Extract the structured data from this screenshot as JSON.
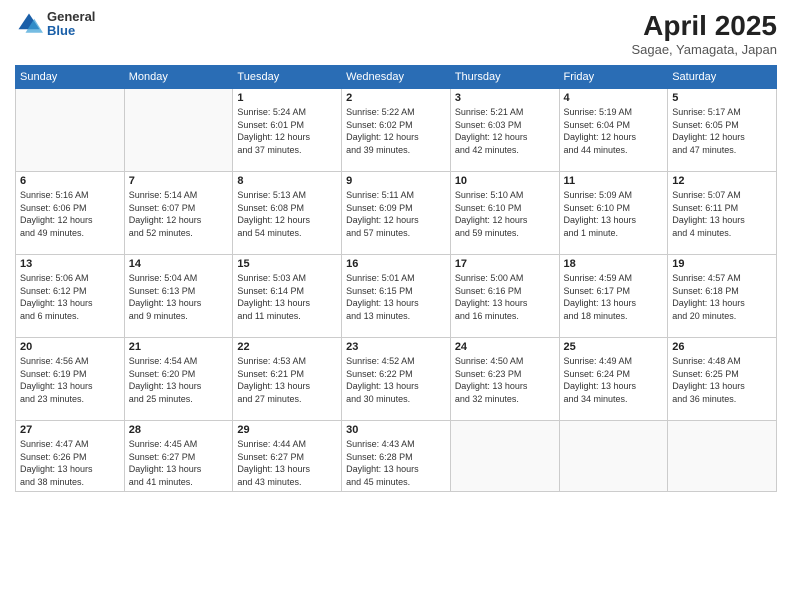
{
  "header": {
    "logo_general": "General",
    "logo_blue": "Blue",
    "month_year": "April 2025",
    "location": "Sagae, Yamagata, Japan"
  },
  "weekdays": [
    "Sunday",
    "Monday",
    "Tuesday",
    "Wednesday",
    "Thursday",
    "Friday",
    "Saturday"
  ],
  "weeks": [
    [
      {
        "day": "",
        "info": ""
      },
      {
        "day": "",
        "info": ""
      },
      {
        "day": "1",
        "info": "Sunrise: 5:24 AM\nSunset: 6:01 PM\nDaylight: 12 hours\nand 37 minutes."
      },
      {
        "day": "2",
        "info": "Sunrise: 5:22 AM\nSunset: 6:02 PM\nDaylight: 12 hours\nand 39 minutes."
      },
      {
        "day": "3",
        "info": "Sunrise: 5:21 AM\nSunset: 6:03 PM\nDaylight: 12 hours\nand 42 minutes."
      },
      {
        "day": "4",
        "info": "Sunrise: 5:19 AM\nSunset: 6:04 PM\nDaylight: 12 hours\nand 44 minutes."
      },
      {
        "day": "5",
        "info": "Sunrise: 5:17 AM\nSunset: 6:05 PM\nDaylight: 12 hours\nand 47 minutes."
      }
    ],
    [
      {
        "day": "6",
        "info": "Sunrise: 5:16 AM\nSunset: 6:06 PM\nDaylight: 12 hours\nand 49 minutes."
      },
      {
        "day": "7",
        "info": "Sunrise: 5:14 AM\nSunset: 6:07 PM\nDaylight: 12 hours\nand 52 minutes."
      },
      {
        "day": "8",
        "info": "Sunrise: 5:13 AM\nSunset: 6:08 PM\nDaylight: 12 hours\nand 54 minutes."
      },
      {
        "day": "9",
        "info": "Sunrise: 5:11 AM\nSunset: 6:09 PM\nDaylight: 12 hours\nand 57 minutes."
      },
      {
        "day": "10",
        "info": "Sunrise: 5:10 AM\nSunset: 6:10 PM\nDaylight: 12 hours\nand 59 minutes."
      },
      {
        "day": "11",
        "info": "Sunrise: 5:09 AM\nSunset: 6:10 PM\nDaylight: 13 hours\nand 1 minute."
      },
      {
        "day": "12",
        "info": "Sunrise: 5:07 AM\nSunset: 6:11 PM\nDaylight: 13 hours\nand 4 minutes."
      }
    ],
    [
      {
        "day": "13",
        "info": "Sunrise: 5:06 AM\nSunset: 6:12 PM\nDaylight: 13 hours\nand 6 minutes."
      },
      {
        "day": "14",
        "info": "Sunrise: 5:04 AM\nSunset: 6:13 PM\nDaylight: 13 hours\nand 9 minutes."
      },
      {
        "day": "15",
        "info": "Sunrise: 5:03 AM\nSunset: 6:14 PM\nDaylight: 13 hours\nand 11 minutes."
      },
      {
        "day": "16",
        "info": "Sunrise: 5:01 AM\nSunset: 6:15 PM\nDaylight: 13 hours\nand 13 minutes."
      },
      {
        "day": "17",
        "info": "Sunrise: 5:00 AM\nSunset: 6:16 PM\nDaylight: 13 hours\nand 16 minutes."
      },
      {
        "day": "18",
        "info": "Sunrise: 4:59 AM\nSunset: 6:17 PM\nDaylight: 13 hours\nand 18 minutes."
      },
      {
        "day": "19",
        "info": "Sunrise: 4:57 AM\nSunset: 6:18 PM\nDaylight: 13 hours\nand 20 minutes."
      }
    ],
    [
      {
        "day": "20",
        "info": "Sunrise: 4:56 AM\nSunset: 6:19 PM\nDaylight: 13 hours\nand 23 minutes."
      },
      {
        "day": "21",
        "info": "Sunrise: 4:54 AM\nSunset: 6:20 PM\nDaylight: 13 hours\nand 25 minutes."
      },
      {
        "day": "22",
        "info": "Sunrise: 4:53 AM\nSunset: 6:21 PM\nDaylight: 13 hours\nand 27 minutes."
      },
      {
        "day": "23",
        "info": "Sunrise: 4:52 AM\nSunset: 6:22 PM\nDaylight: 13 hours\nand 30 minutes."
      },
      {
        "day": "24",
        "info": "Sunrise: 4:50 AM\nSunset: 6:23 PM\nDaylight: 13 hours\nand 32 minutes."
      },
      {
        "day": "25",
        "info": "Sunrise: 4:49 AM\nSunset: 6:24 PM\nDaylight: 13 hours\nand 34 minutes."
      },
      {
        "day": "26",
        "info": "Sunrise: 4:48 AM\nSunset: 6:25 PM\nDaylight: 13 hours\nand 36 minutes."
      }
    ],
    [
      {
        "day": "27",
        "info": "Sunrise: 4:47 AM\nSunset: 6:26 PM\nDaylight: 13 hours\nand 38 minutes."
      },
      {
        "day": "28",
        "info": "Sunrise: 4:45 AM\nSunset: 6:27 PM\nDaylight: 13 hours\nand 41 minutes."
      },
      {
        "day": "29",
        "info": "Sunrise: 4:44 AM\nSunset: 6:27 PM\nDaylight: 13 hours\nand 43 minutes."
      },
      {
        "day": "30",
        "info": "Sunrise: 4:43 AM\nSunset: 6:28 PM\nDaylight: 13 hours\nand 45 minutes."
      },
      {
        "day": "",
        "info": ""
      },
      {
        "day": "",
        "info": ""
      },
      {
        "day": "",
        "info": ""
      }
    ]
  ]
}
